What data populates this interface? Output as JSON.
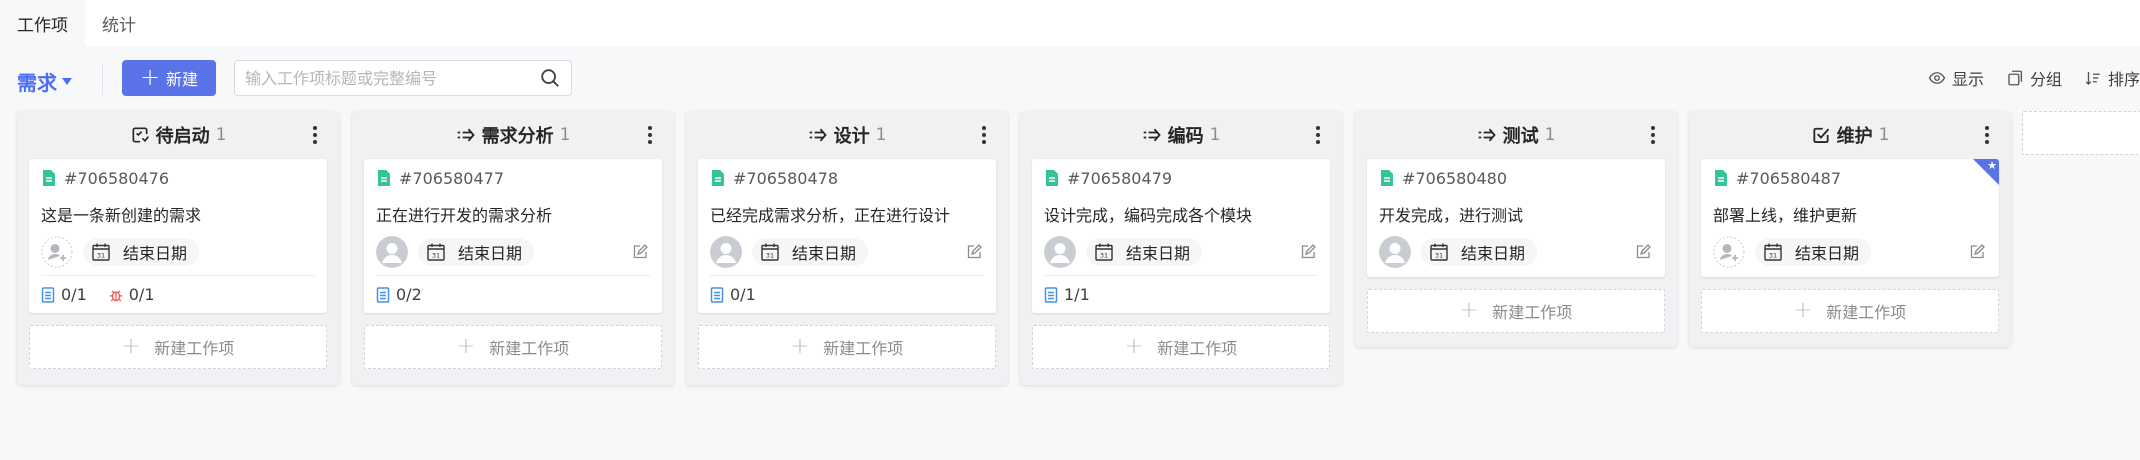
{
  "tabs": [
    {
      "label": "工作项",
      "active": true
    },
    {
      "label": "统计",
      "active": false
    }
  ],
  "toolbar": {
    "type_select": "需求",
    "new_label": "新建",
    "search_placeholder": "输入工作项标题或完整编号",
    "display_label": "显示",
    "group_label": "分组",
    "sort_label": "排序"
  },
  "colors": {
    "accent": "#5b73e8",
    "link": "#4c6ef5",
    "doc_icon": "#34c39a",
    "task_icon": "#4a90e2",
    "bug_icon": "#f0504f"
  },
  "add_item_label": "新建工作项",
  "date_label": "结束日期",
  "columns": [
    {
      "name": "待启动",
      "count": "1",
      "icon": "not-started-icon",
      "card": {
        "id": "#706580476",
        "title": "这是一条新创建的需求",
        "assignee": "unassigned",
        "editable": false,
        "stats": [
          {
            "kind": "task",
            "value": "0/1"
          },
          {
            "kind": "bug",
            "value": "0/1"
          }
        ],
        "flag": false
      }
    },
    {
      "name": "需求分析",
      "count": "1",
      "icon": "progress-arrow-icon",
      "card": {
        "id": "#706580477",
        "title": "正在进行开发的需求分析",
        "assignee": "member",
        "editable": true,
        "stats": [
          {
            "kind": "task",
            "value": "0/2"
          }
        ],
        "flag": false
      }
    },
    {
      "name": "设计",
      "count": "1",
      "icon": "progress-arrow-icon",
      "card": {
        "id": "#706580478",
        "title": "已经完成需求分析，正在进行设计",
        "assignee": "member",
        "editable": true,
        "stats": [
          {
            "kind": "task",
            "value": "0/1"
          }
        ],
        "flag": false
      }
    },
    {
      "name": "编码",
      "count": "1",
      "icon": "progress-arrow-icon",
      "card": {
        "id": "#706580479",
        "title": "设计完成，编码完成各个模块",
        "assignee": "member",
        "editable": true,
        "stats": [
          {
            "kind": "task",
            "value": "1/1"
          }
        ],
        "flag": false
      }
    },
    {
      "name": "测试",
      "count": "1",
      "icon": "progress-arrow-icon",
      "card": {
        "id": "#706580480",
        "title": "开发完成，进行测试",
        "assignee": "member",
        "editable": true,
        "stats": [],
        "flag": false
      }
    },
    {
      "name": "维护",
      "count": "1",
      "icon": "done-check-icon",
      "card": {
        "id": "#706580487",
        "title": "部署上线，维护更新",
        "assignee": "unassigned",
        "editable": true,
        "stats": [],
        "flag": true
      }
    }
  ]
}
